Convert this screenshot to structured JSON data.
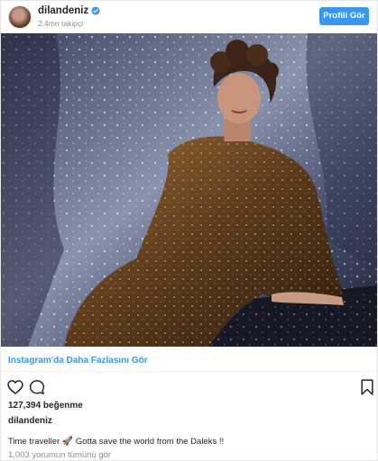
{
  "header": {
    "username": "dilandeniz",
    "followers": "2.4mn takipçi",
    "profile_button": "Profili Gör",
    "verified_icon": "verified-badge-icon",
    "accent_color": "#3897f0"
  },
  "photo": {
    "alt": "Woman in a bronze sequin dress reclining before a silver sequin backdrop"
  },
  "more_link": "Instagram'da Daha Fazlasını Gör",
  "actions": {
    "like_icon": "heart-icon",
    "comment_icon": "comment-bubble-icon",
    "save_icon": "bookmark-icon"
  },
  "likes": "127,394 beğenme",
  "author": "dilandeniz",
  "caption": {
    "text_before": "Time traveller",
    "emoji": "🚀",
    "text_after": "Gotta save the world from the Daleks !!"
  },
  "comments_link": "1,003 yorumun tümünü gör"
}
